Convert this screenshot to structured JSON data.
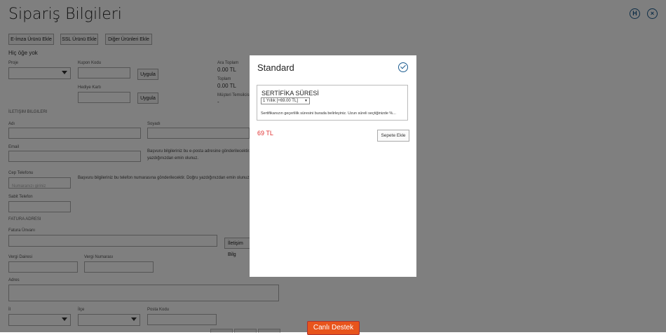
{
  "page": {
    "title": "Sipariş Bilgileri",
    "icons": [
      "help-h-icon",
      "close-icon"
    ]
  },
  "toolbar": {
    "esign_label": "E-İmza Ürünü Ekle",
    "ssl_label": "SSL Ürünü Ekle",
    "other_label": "Diğer Ürünleri Ekle"
  },
  "cart": {
    "empty_text": "Hiç öğe yok",
    "period_label": "Proje",
    "coupon_label": "Kupon Kodu",
    "gift_label": "Hediye Kartı",
    "apply_label": "Uygula",
    "subtotal_label": "Ara Toplam",
    "subtotal_value": "0.00 TL",
    "total_label": "Toplam",
    "total_value": "0.00 TL",
    "rep_label": "Müşteri Temsilcisi",
    "rep_value": "-"
  },
  "contact": {
    "section": "İletişim Bilgileri",
    "name_label": "Adı",
    "surname_label": "Soyadı",
    "email_label": "Email",
    "email_note_1": "Başvuru bilgileriniz bu e-posta adresine gönderilecektir.",
    "email_note_2": "yazdığınızdan emin olunuz.",
    "phone_label": "Cep Telefonu",
    "phone_placeholder": "Numaranızı giriniz",
    "phone_note": "Başvuru bilgileriniz bu telefon numarasına gönderilecektir. Doğru yazdığınızdan emin olunuz.",
    "landline_label": "Sabit Telefon"
  },
  "invoice": {
    "section": "Fatura Adresi",
    "title_label": "Fatura Ünvanı",
    "copy_label": "İletişim Bilg",
    "tax_office_label": "Vergi Dairesi",
    "tax_no_label": "Vergi Numarası",
    "address_label": "Adres",
    "city_label": "İl",
    "district_label": "İlçe",
    "postal_label": "Posta Kodu"
  },
  "modal": {
    "title": "Standard",
    "option_title": "SERTİFİKA SÜRESİ",
    "selected_option": "1 Yıllık [+69.00 TL]",
    "description": "Sertifikanızın geçerlilik süresini burada belirleyiniz. Uzun süreli seçtiğinizde %...",
    "price": "69 TL",
    "add_label": "Sepete Ekle"
  },
  "support": {
    "label": "Canlı Destek"
  }
}
